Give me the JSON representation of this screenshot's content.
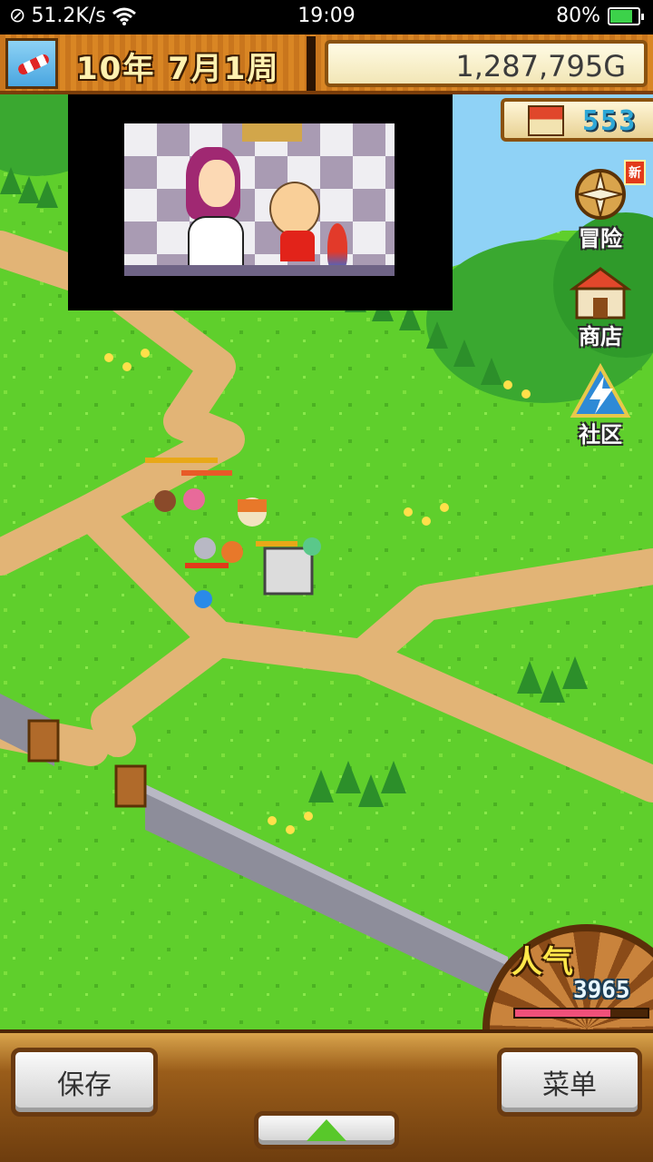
{
  "status_bar": {
    "net_speed": "51.2K/s",
    "time": "19:09",
    "battery": "80%",
    "battery_level": 0.8
  },
  "hud": {
    "date": "10年 7月1周",
    "gold": "1,287,795G"
  },
  "town_rank": {
    "value": "553",
    "icon": "town-house-icon"
  },
  "side_menu": {
    "adventure": {
      "label": "冒险",
      "badge": "新",
      "icon": "compass-icon"
    },
    "shop": {
      "label": "商店",
      "icon": "shop-icon"
    },
    "community": {
      "label": "社区",
      "icon": "community-icon"
    }
  },
  "popularity": {
    "title": "人气",
    "value": "3965",
    "level": 0.72
  },
  "bottom_bar": {
    "save_label": "保存",
    "menu_label": "菜单",
    "expand_icon": "triangle-up-icon"
  },
  "colors": {
    "grass": "#5fcf2c",
    "path": "#e2b476",
    "hud_wood": "#d98624",
    "accent_green": "#58c82a"
  }
}
